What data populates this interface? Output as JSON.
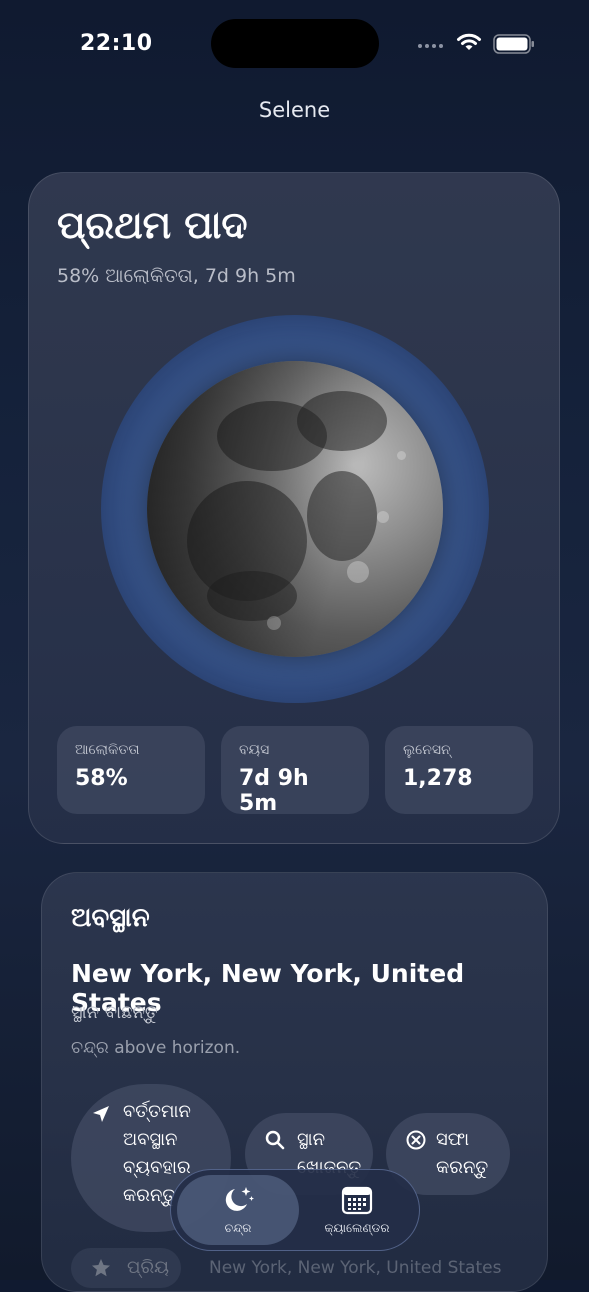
{
  "status_bar": {
    "time": "22:10"
  },
  "nav": {
    "title": "Selene"
  },
  "phase": {
    "name": "ପ୍ରଥମ ପାଦ",
    "summary": "58% ଆଲୋକିତତା, 7d 9h 5m",
    "stats": [
      {
        "label": "ଆଲୋକିତତା",
        "value": "58%"
      },
      {
        "label": "ବୟସ",
        "value": "7d 9h 5m"
      },
      {
        "label": "ଲୁନେସନ୍",
        "value": "1,278"
      }
    ]
  },
  "location": {
    "heading": "ଅବସ୍ଥାନ",
    "city": "New York, New York, United States",
    "search_hint": "ସ୍ଥାନ ବାଛନ୍ତୁ",
    "visibility": "ଚନ୍ଦ୍ର above horizon.",
    "buttons": {
      "current": [
        "ବର୍ତ୍ତମାନ",
        "ଅବସ୍ଥାନ",
        "ବ୍ୟବହାର",
        "କରନ୍ତୁ"
      ],
      "search": [
        "ସ୍ଥାନ",
        "ଖୋଜନ୍ତୁ"
      ],
      "clear": [
        "ସଫା",
        "କରନ୍ତୁ"
      ]
    },
    "favorite": {
      "label": "ପ୍ରିୟ",
      "location": "New York, New York, United States"
    }
  },
  "tabs": [
    {
      "label": "ଚନ୍ଦ୍ର",
      "icon": "moon-stars-icon",
      "selected": true
    },
    {
      "label": "କ୍ୟାଲେଣ୍ଡର",
      "icon": "calendar-icon",
      "selected": false
    }
  ],
  "colors": {
    "accent": "#5a78b0",
    "background": "#15223b"
  }
}
